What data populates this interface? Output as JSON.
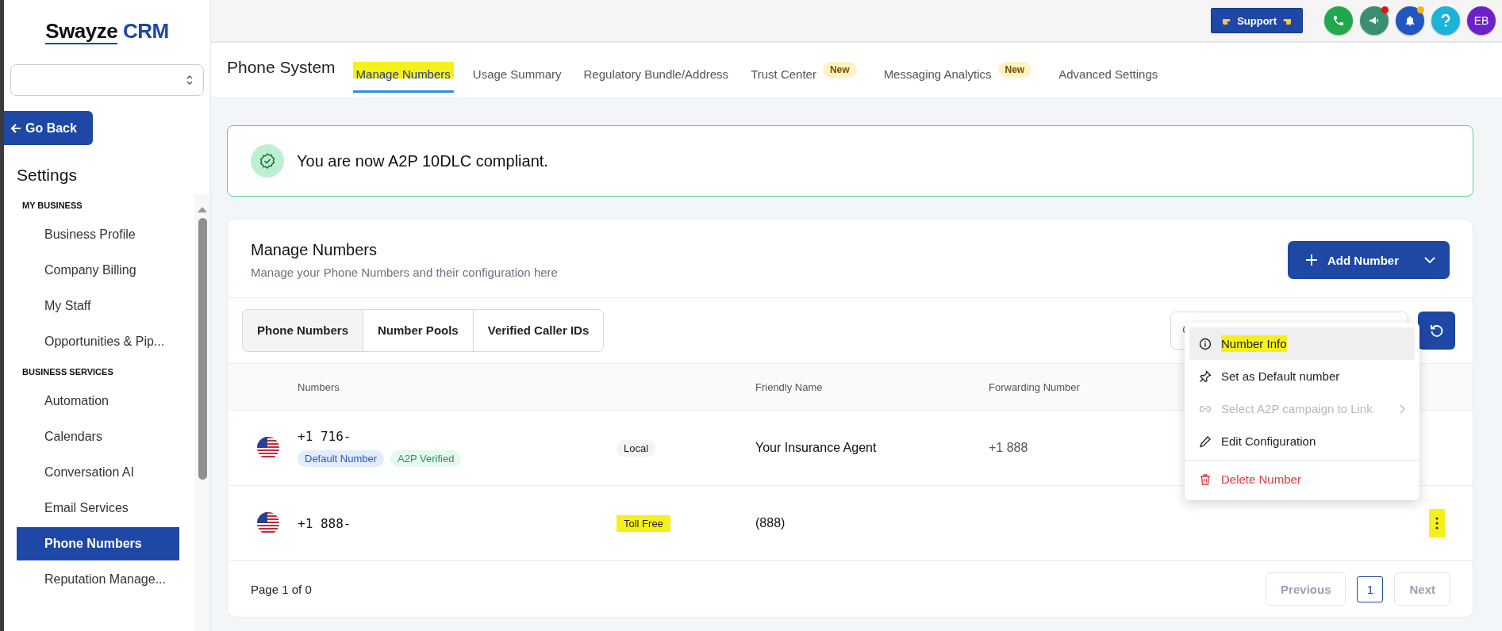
{
  "logo": {
    "text": "Swayze",
    "accent": "CRM"
  },
  "go_back": "Go Back",
  "sidebar": {
    "title": "Settings",
    "sections": [
      {
        "heading": "MY BUSINESS",
        "items": [
          {
            "label": "Business Profile",
            "selected": false
          },
          {
            "label": "Company Billing",
            "selected": false
          },
          {
            "label": "My Staff",
            "selected": false
          },
          {
            "label": "Opportunities & Pip...",
            "selected": false
          }
        ]
      },
      {
        "heading": "BUSINESS SERVICES",
        "items": [
          {
            "label": "Automation",
            "selected": false
          },
          {
            "label": "Calendars",
            "selected": false
          },
          {
            "label": "Conversation AI",
            "selected": false
          },
          {
            "label": "Email Services",
            "selected": false
          },
          {
            "label": "Phone Numbers",
            "selected": true
          },
          {
            "label": "Reputation Manage...",
            "selected": false
          }
        ]
      }
    ]
  },
  "topbar": {
    "support": "Support",
    "avatar": "EB"
  },
  "header": {
    "title": "Phone System",
    "tabs": [
      {
        "label": "Manage Numbers",
        "selected": true,
        "highlighted": true
      },
      {
        "label": "Usage Summary",
        "selected": false,
        "highlighted": false
      },
      {
        "label": "Regulatory Bundle/Address",
        "selected": false,
        "highlighted": false
      },
      {
        "label": "Trust Center",
        "selected": false,
        "highlighted": false,
        "badge": "New"
      },
      {
        "label": "Messaging Analytics",
        "selected": false,
        "highlighted": false,
        "badge": "New"
      },
      {
        "label": "Advanced Settings",
        "selected": false,
        "highlighted": false
      }
    ]
  },
  "banner": {
    "text": "You are now A2P 10DLC compliant."
  },
  "card": {
    "title": "Manage Numbers",
    "subtitle": "Manage your Phone Numbers and their configuration here",
    "add_button": "Add Number",
    "segments": [
      {
        "label": "Phone Numbers",
        "selected": true
      },
      {
        "label": "Number Pools",
        "selected": false
      },
      {
        "label": "Verified Caller IDs",
        "selected": false
      }
    ],
    "columns": {
      "numbers": "Numbers",
      "friendly": "Friendly Name",
      "forwarding": "Forwarding Number"
    },
    "rows": [
      {
        "number": "+1 716-",
        "tags": [
          {
            "label": "Default Number",
            "kind": "default"
          },
          {
            "label": "A2P Verified",
            "kind": "verified"
          }
        ],
        "type": "Local",
        "type_highlighted": false,
        "friendly_name": "Your Insurance Agent",
        "forwarding": "+1 888"
      },
      {
        "number": "+1 888-",
        "tags": [],
        "type": "Toll Free",
        "type_highlighted": true,
        "friendly_name": "(888)",
        "menu_button": {
          "highlighted": true
        }
      }
    ],
    "pagination": {
      "page_text": "Page 1 of 0",
      "previous": "Previous",
      "current": "1",
      "next": "Next"
    }
  },
  "context_menu": {
    "items": [
      {
        "label": "Number Info",
        "kind": "info",
        "highlighted": true,
        "disabled": false
      },
      {
        "label": "Set as Default number",
        "kind": "pin",
        "highlighted": false,
        "disabled": false
      },
      {
        "label": "Select A2P campaign to Link",
        "kind": "link",
        "highlighted": false,
        "disabled": true,
        "submenu": true
      },
      {
        "label": "Edit Configuration",
        "kind": "edit",
        "highlighted": false,
        "disabled": false
      },
      {
        "label": "Delete Number",
        "kind": "delete",
        "highlighted": false,
        "disabled": false
      }
    ]
  }
}
